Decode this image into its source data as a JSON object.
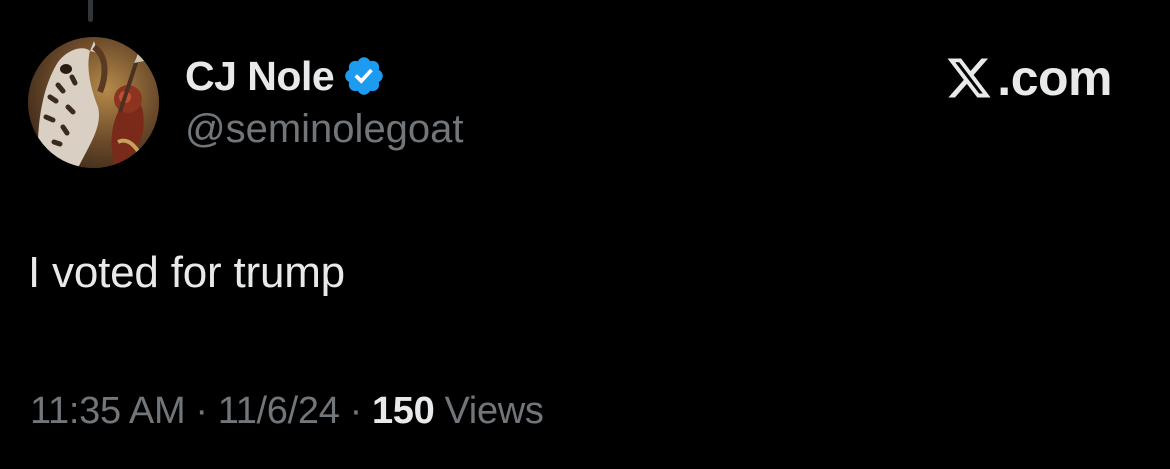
{
  "author": {
    "display_name": "CJ Nole",
    "handle": "@seminolegoat",
    "verified": true,
    "verified_badge_color": "#1d9bf0",
    "avatar_icon": "horse-warrior-avatar"
  },
  "brand": {
    "label": ".com",
    "icon": "x-logo-icon"
  },
  "tweet": {
    "text": "I voted for trump"
  },
  "meta": {
    "time": "11:35 AM",
    "separator": "·",
    "date": "11/6/24",
    "views_count": "150",
    "views_label": "Views"
  },
  "colors": {
    "background": "#000000",
    "primary_text": "#e7e9ea",
    "secondary_text": "#71767b"
  }
}
